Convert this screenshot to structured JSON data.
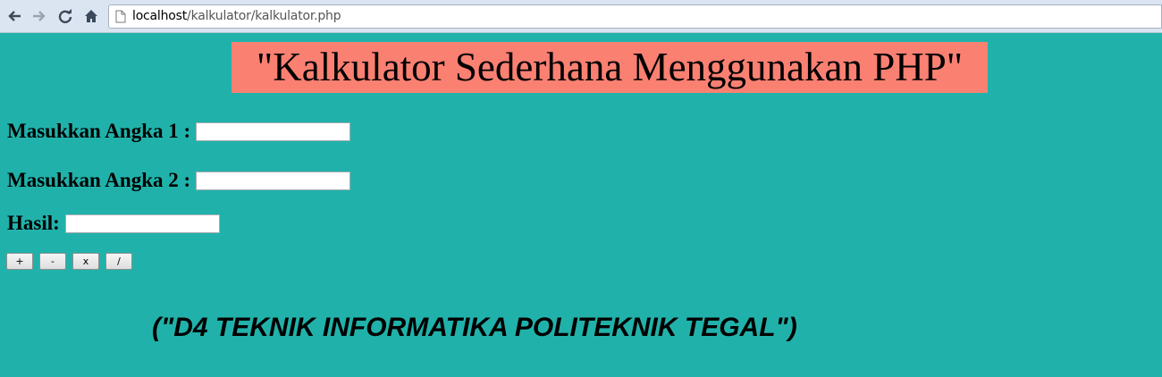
{
  "browser": {
    "url_host": "localhost",
    "url_path": "/kalkulator/kalkulator.php",
    "icons": [
      "back-icon",
      "forward-icon",
      "reload-icon",
      "home-icon",
      "page-icon"
    ]
  },
  "page": {
    "background_color": "#20b2aa",
    "title": "\"Kalkulator Sederhana Menggunakan PHP\"",
    "title_background": "#fa8072",
    "fields": {
      "angka1": {
        "label": "Masukkan Angka 1 :",
        "value": ""
      },
      "angka2": {
        "label": "Masukkan Angka 2 :",
        "value": ""
      },
      "hasil": {
        "label": "Hasil:",
        "value": ""
      }
    },
    "buttons": {
      "add": "+",
      "subtract": "-",
      "multiply": "x",
      "divide": "/"
    },
    "footer": "(\"D4 TEKNIK INFORMATIKA POLITEKNIK TEGAL\")"
  }
}
